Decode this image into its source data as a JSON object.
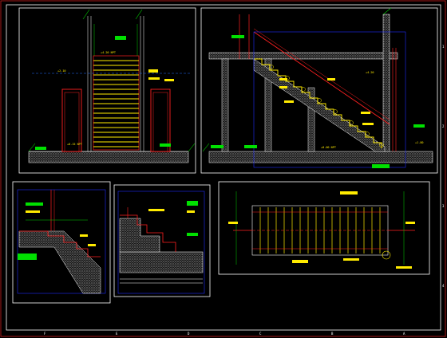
{
  "drawing": {
    "grid_letters_bottom": [
      "F",
      "E",
      "D",
      "C",
      "B",
      "A"
    ],
    "grid_numbers_right": [
      "1",
      "2",
      "3",
      "4"
    ],
    "elevation_texts": [
      "+4.20 NPT",
      "+2.10",
      "+0.15 NPT",
      "+0.00 NPT",
      "+4.20",
      "+1.80"
    ],
    "colors": {
      "background": "#000000",
      "frame": "#ffffff",
      "stair_tread": "#ffeb00",
      "wall": "#ff2020",
      "dimension": "#00d000",
      "hatch": "#9a9a9a",
      "section_box": "#1e2cff",
      "highlight_block": "#00e000",
      "label_block": "#ffeb00"
    }
  }
}
